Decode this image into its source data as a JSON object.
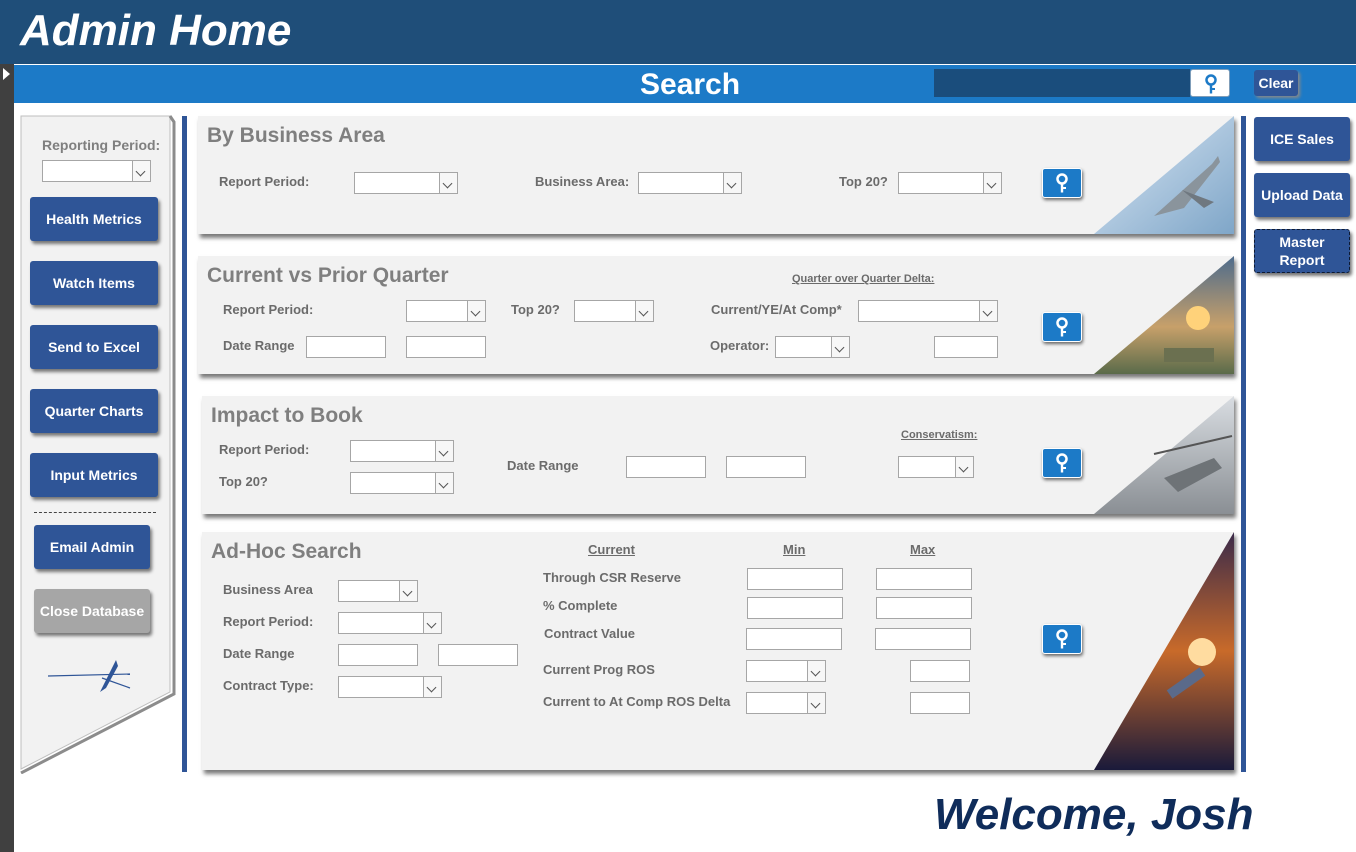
{
  "header": {
    "title": "Admin Home"
  },
  "search": {
    "title": "Search",
    "value": "",
    "clear_label": "Clear"
  },
  "sidebar": {
    "reporting_period_label": "Reporting Period:",
    "reporting_period_value": "",
    "items": [
      {
        "label": "Health Metrics"
      },
      {
        "label": "Watch Items"
      },
      {
        "label": "Send to Excel"
      },
      {
        "label": "Quarter Charts"
      },
      {
        "label": "Input Metrics"
      },
      {
        "label": "Email Admin"
      },
      {
        "label": "Close Database"
      }
    ]
  },
  "sections": {
    "business_area": {
      "title": "By Business Area",
      "report_period_label": "Report Period:",
      "business_area_label": "Business Area:",
      "top20_label": "Top 20?"
    },
    "quarter": {
      "title": "Current vs Prior Quarter",
      "delta_label": "Quarter over Quarter Delta:",
      "report_period_label": "Report Period:",
      "top20_label": "Top 20?",
      "comp_label": "Current/YE/At Comp*",
      "date_range_label": "Date Range",
      "operator_label": "Operator:"
    },
    "impact": {
      "title": "Impact to Book",
      "report_period_label": "Report Period:",
      "top20_label": "Top 20?",
      "date_range_label": "Date Range",
      "conservatism_label": "Conservatism:"
    },
    "adhoc": {
      "title": "Ad-Hoc Search",
      "business_area_label": "Business Area",
      "report_period_label": "Report Period:",
      "date_range_label": "Date Range",
      "contract_type_label": "Contract Type:",
      "col_current": "Current",
      "col_min": "Min",
      "col_max": "Max",
      "rows": [
        {
          "label": "Through CSR Reserve"
        },
        {
          "label": "% Complete"
        },
        {
          "label": "Contract Value"
        },
        {
          "label": "Current Prog ROS"
        },
        {
          "label": "Current to At Comp ROS Delta"
        }
      ]
    }
  },
  "right": {
    "ice_sales": "ICE Sales",
    "upload_data": "Upload Data",
    "master_report": "Master Report"
  },
  "footer": {
    "welcome": "Welcome, Josh"
  },
  "colors": {
    "header": "#1f4e79",
    "accent": "#1c7ac7",
    "button": "#2f5597"
  },
  "icons": [
    "key-icon",
    "play-arrow-icon",
    "logo-star-icon"
  ]
}
